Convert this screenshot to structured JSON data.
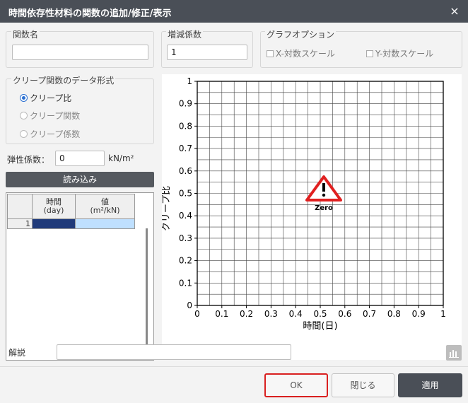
{
  "window": {
    "title": "時間依存性材料の関数の追加/修正/表示",
    "close_glyph": "×"
  },
  "function_name": {
    "label": "関数名",
    "value": ""
  },
  "scale_factor": {
    "label": "増減係数",
    "value": "1"
  },
  "graph_options": {
    "label": "グラフオプション",
    "x_log": {
      "label": "X-対数スケール",
      "checked": false
    },
    "y_log": {
      "label": "Y-対数スケール",
      "checked": false
    }
  },
  "data_format": {
    "label": "クリープ関数のデータ形式",
    "options": [
      {
        "label": "クリープ比",
        "selected": true
      },
      {
        "label": "クリープ関数",
        "selected": false
      },
      {
        "label": "クリープ係数",
        "selected": false
      }
    ]
  },
  "elastic_modulus": {
    "label": "弾性係数：",
    "value": "0",
    "unit": "kN/m²"
  },
  "import_button": "読み込み",
  "table": {
    "headers": [
      {
        "line1": "時間",
        "line2": "(day)"
      },
      {
        "line1": "値",
        "line2": "(m²/kN)"
      }
    ],
    "rows": [
      {
        "index": "1",
        "time": "",
        "value": ""
      }
    ]
  },
  "chart_data": {
    "type": "line",
    "xlabel": "時間(日)",
    "ylabel": "クリープ比",
    "xlim": [
      0,
      1
    ],
    "ylim": [
      0,
      1
    ],
    "x_ticks": [
      "0",
      "0.1",
      "0.2",
      "0.3",
      "0.4",
      "0.5",
      "0.6",
      "0.7",
      "0.8",
      "0.9",
      "1"
    ],
    "y_ticks": [
      "0",
      "0.1",
      "0.2",
      "0.3",
      "0.4",
      "0.5",
      "0.6",
      "0.7",
      "0.8",
      "0.9",
      "1"
    ],
    "grid": true,
    "series": [],
    "warning_label": "Zero"
  },
  "description": {
    "label": "解説",
    "value": ""
  },
  "buttons": {
    "ok": "OK",
    "close": "閉じる",
    "apply": "適用"
  },
  "colors": {
    "titlebar": "#4a4f57",
    "selected_cell": "#1f3a7a",
    "highlight_cell": "#bfe0ff",
    "warning": "#e02020",
    "ok_border": "#d92020"
  }
}
